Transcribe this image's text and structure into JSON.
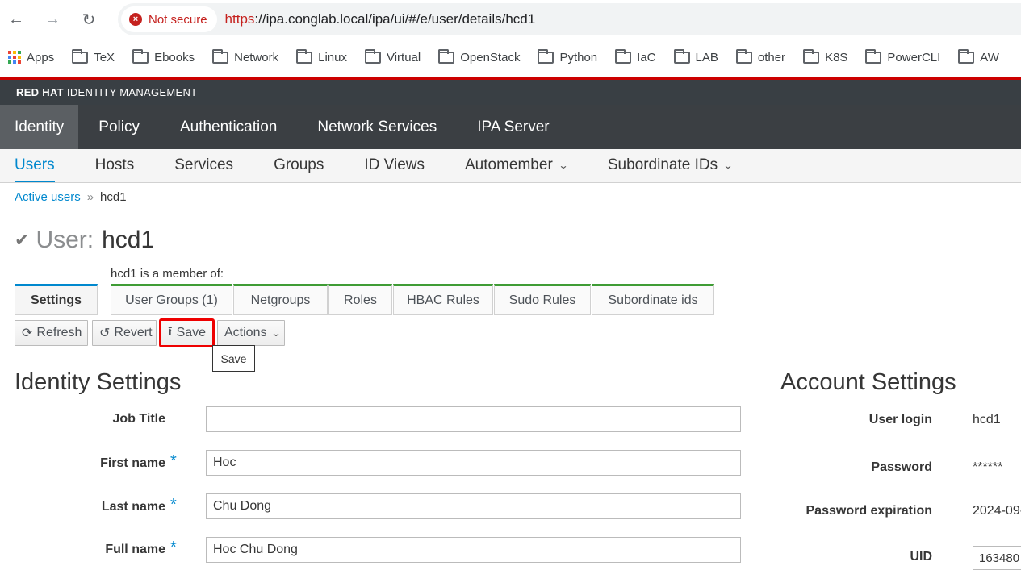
{
  "browser": {
    "security_label": "Not secure",
    "url_scheme": "https",
    "url_rest": "://ipa.conglab.local/ipa/ui/#/e/user/details/hcd1",
    "bookmarks": [
      "Apps",
      "TeX",
      "Ebooks",
      "Network",
      "Linux",
      "Virtual",
      "OpenStack",
      "Python",
      "IaC",
      "LAB",
      "other",
      "K8S",
      "PowerCLI",
      "AW"
    ]
  },
  "brand": {
    "bold": "RED HAT",
    "rest": "IDENTITY MANAGEMENT"
  },
  "main_nav": [
    "Identity",
    "Policy",
    "Authentication",
    "Network Services",
    "IPA Server"
  ],
  "sub_nav": [
    "Users",
    "Hosts",
    "Services",
    "Groups",
    "ID Views",
    "Automember",
    "Subordinate IDs"
  ],
  "breadcrumb": {
    "parent": "Active users",
    "sep": "»",
    "current": "hcd1"
  },
  "page": {
    "entity": "User:",
    "name": "hcd1",
    "member_of": "hcd1 is a member of:"
  },
  "tabs": [
    "Settings",
    "User Groups (1)",
    "Netgroups",
    "Roles",
    "HBAC Rules",
    "Sudo Rules",
    "Subordinate ids"
  ],
  "toolbar": {
    "refresh": "Refresh",
    "revert": "Revert",
    "save": "Save",
    "actions": "Actions",
    "tooltip": "Save"
  },
  "identity": {
    "title": "Identity Settings",
    "job_title_label": "Job Title",
    "job_title_value": "",
    "first_name_label": "First name",
    "first_name_value": "Hoc",
    "last_name_label": "Last name",
    "last_name_value": "Chu Dong",
    "full_name_label": "Full name",
    "full_name_value": "Hoc Chu Dong"
  },
  "account": {
    "title": "Account Settings",
    "user_login_label": "User login",
    "user_login_value": "hcd1",
    "password_label": "Password",
    "password_value": "******",
    "password_exp_label": "Password expiration",
    "password_exp_value": "2024-09-",
    "uid_label": "UID",
    "uid_value": "163480"
  },
  "colors": {
    "accent": "#0088ce",
    "brand_red": "#cc0000",
    "nav_bg": "#3b3f43",
    "tab_green": "#3f9c35"
  }
}
